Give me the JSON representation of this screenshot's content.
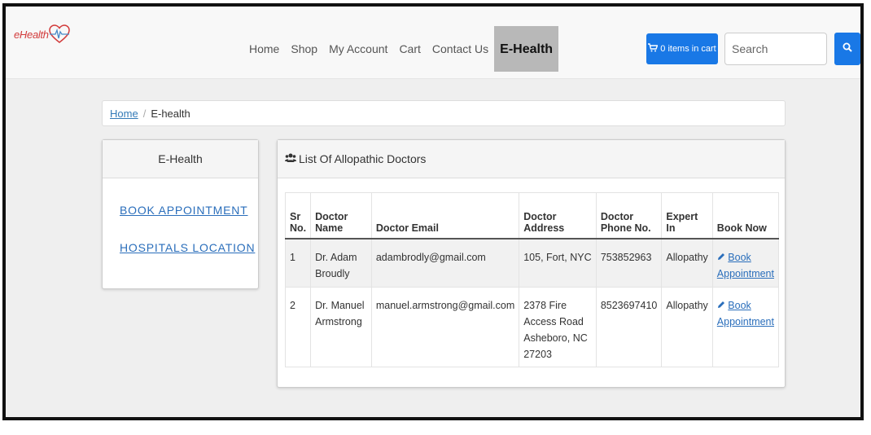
{
  "brand": {
    "name": "eHealth"
  },
  "nav": {
    "items": [
      {
        "label": "Home"
      },
      {
        "label": "Shop"
      },
      {
        "label": "My Account"
      },
      {
        "label": "Cart"
      },
      {
        "label": "Contact Us"
      },
      {
        "label": "E-Health"
      }
    ],
    "active": "E-Health"
  },
  "cart": {
    "label": "0 items in cart"
  },
  "search": {
    "placeholder": "Search",
    "value": ""
  },
  "breadcrumb": {
    "home": "Home",
    "current": "E-health"
  },
  "sidebar": {
    "title": "E-Health",
    "links": [
      {
        "label": "BOOK APPOINTMENT"
      },
      {
        "label": "HOSPITALS LOCATION"
      }
    ]
  },
  "main": {
    "title": "List Of Allopathic Doctors",
    "columns": [
      "Sr No.",
      "Doctor Name",
      "Doctor Email",
      "Doctor Address",
      "Doctor Phone No.",
      "Expert In",
      "Book Now"
    ],
    "rows": [
      {
        "sr": "1",
        "name": "Dr. Adam Broudly",
        "email": "adambrodly@gmail.com",
        "address": "105, Fort, NYC",
        "phone": "753852963",
        "expert": "Allopathy",
        "book": "Book Appointment"
      },
      {
        "sr": "2",
        "name": "Dr. Manuel Armstrong",
        "email": "manuel.armstrong@gmail.com",
        "address": "2378 Fire Access Road Asheboro, NC 27203",
        "phone": "8523697410",
        "expert": "Allopathy",
        "book": "Book Appointment"
      }
    ]
  },
  "colors": {
    "accent": "#1978e6",
    "brand": "#d23b3b",
    "link": "#2a6ebb"
  }
}
